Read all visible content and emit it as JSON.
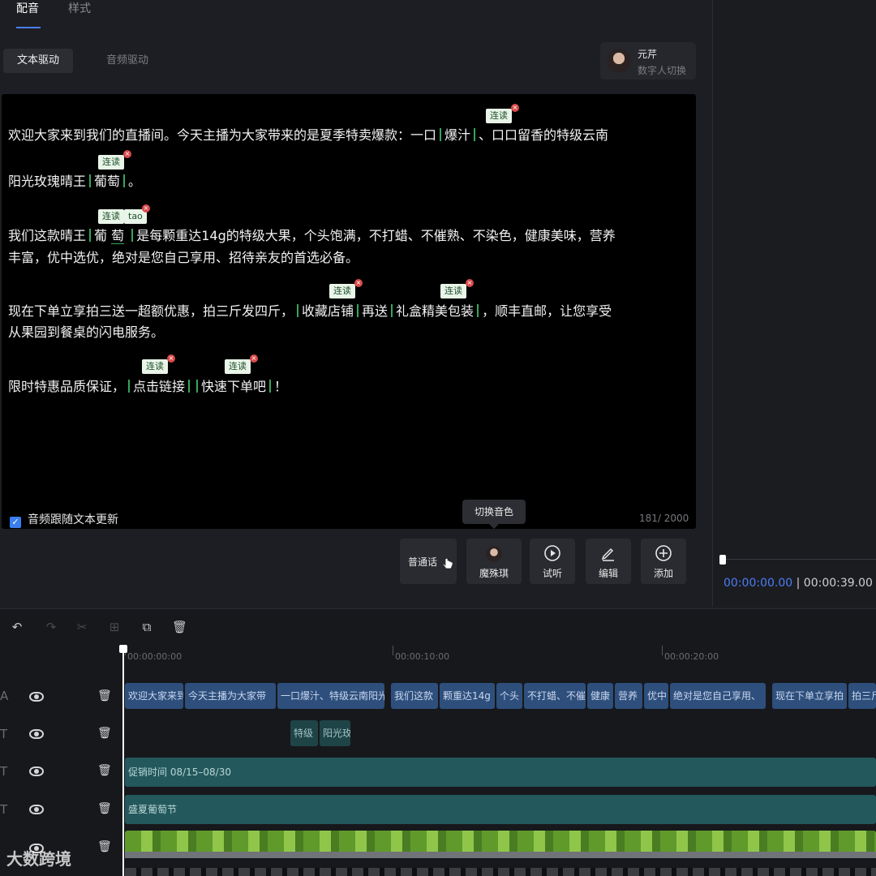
{
  "top_tabs": [
    "配音",
    "样式"
  ],
  "drive_tabs": [
    "文本驱动",
    "音频驱动"
  ],
  "digital_human": {
    "name": "元芹",
    "switch_label": "数字人切换"
  },
  "editor": {
    "lines": [
      [
        "欢迎大家来到我们的直播间。今天主播为大家带来的是夏季特卖爆款：一口",
        "爆汁",
        "、口口留香的特级云南"
      ],
      [
        "阳光玫瑰晴王",
        "葡萄",
        "。"
      ],
      [
        "我们这款晴王",
        "葡",
        "萄",
        "是每颗重达14g的特级大果，个头饱满，不打蜡、不催熟、不染色，健康美味，营养"
      ],
      [
        "丰富，优中选优，绝对是您自己享用、招待亲友的首选必备。"
      ],
      [
        "现在下单立享拍三送一超额优惠，拍三斤发四斤，",
        "收藏店铺",
        "再送",
        "礼盒精美包装",
        "，顺丰直邮，让您享受"
      ],
      [
        "从果园到餐桌的闪电服务。"
      ],
      [
        "限时特惠品质保证，",
        "点击链接",
        "快速下单吧",
        "！"
      ]
    ],
    "badge_label": "连读",
    "pinyin_badge": "tao",
    "close_glyph": "×",
    "follow_label": "音频跟随文本更新",
    "char_count": "181/ 2000"
  },
  "tooltip": "切换音色",
  "toolbar": {
    "dialect": "普通话",
    "voice": "魔殊琪",
    "listen": "试听",
    "edit": "编辑",
    "add": "添加"
  },
  "preview": {
    "current_time": "00:00:00.00",
    "separator": " | ",
    "total_time": "00:00:39.00"
  },
  "timeline": {
    "ruler": [
      "00:00:00:00",
      "00:00:10:00",
      "00:00:20:00"
    ],
    "tracks": [
      {
        "type_icon": "A",
        "clips": [
          "欢迎大家来到",
          "今天主播为大家带",
          "一口爆汁、特级云南阳光",
          "我们这款",
          "颗重达14g",
          "个头",
          "不打蜡、不催",
          "健康",
          "营养",
          "优中",
          "绝对是您自己享用、",
          "现在下单立享拍",
          "拍三斤"
        ]
      },
      {
        "type_icon": "T",
        "clips": [
          "特级",
          "阳光玫"
        ]
      },
      {
        "type_icon": "T",
        "clips": [
          "促销时间 08/15–08/30"
        ]
      },
      {
        "type_icon": "T",
        "clips": [
          "盛夏葡萄节"
        ]
      }
    ]
  },
  "watermark": "大数跨境",
  "colors": {
    "accent": "#4a7df7",
    "badge_bg": "#e9f5e9",
    "pause_mark": "#37a55a",
    "clip_blue": "#2e4f7c",
    "clip_teal": "#23585c"
  }
}
